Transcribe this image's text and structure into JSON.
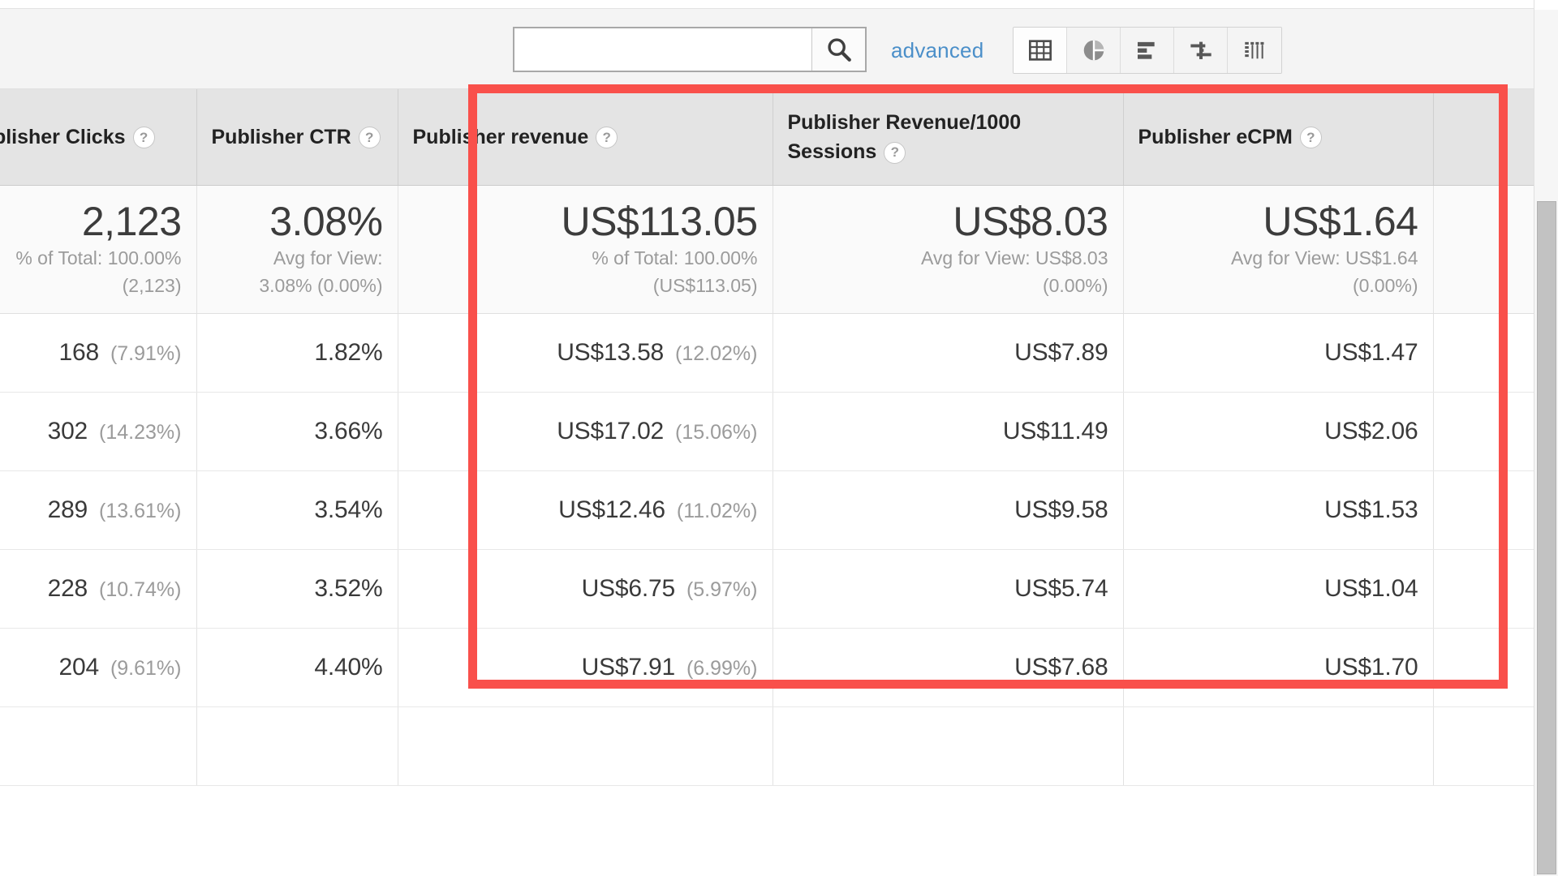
{
  "toolbar": {
    "search_value": "",
    "search_placeholder": "",
    "search_icon": "search-icon",
    "advanced_label": "advanced",
    "view_buttons": [
      {
        "name": "table-view",
        "icon": "table-grid-icon",
        "active": true
      },
      {
        "name": "percentage-view",
        "icon": "pie-chart-icon",
        "active": false
      },
      {
        "name": "performance-view",
        "icon": "horizontal-bar-icon",
        "active": false
      },
      {
        "name": "comparison-view",
        "icon": "pivot-flow-icon",
        "active": false
      },
      {
        "name": "pivot-view",
        "icon": "term-cloud-icon",
        "active": false
      }
    ]
  },
  "annotation": {
    "color": "#f9504b",
    "highlights_columns": [
      "Publisher revenue",
      "Publisher Revenue/1000 Sessions",
      "Publisher eCPM"
    ]
  },
  "table": {
    "columns": [
      {
        "label": "Publisher Clicks",
        "help": "?",
        "truncated_left": true
      },
      {
        "label": "Publisher CTR",
        "help": "?",
        "truncated_left": false
      },
      {
        "label": "Publisher revenue",
        "help": "?",
        "truncated_left": false
      },
      {
        "label": "Publisher Revenue/1000 Sessions",
        "help": "?",
        "truncated_left": false
      },
      {
        "label": "Publisher eCPM",
        "help": "?",
        "truncated_left": false
      }
    ],
    "summary": [
      {
        "main": "2,123",
        "sub1": "% of Total: 100.00%",
        "sub2": "(2,123)"
      },
      {
        "main": "3.08%",
        "sub1": "Avg for View:",
        "sub2": "3.08% (0.00%)"
      },
      {
        "main": "US$113.05",
        "sub1": "% of Total: 100.00%",
        "sub2": "(US$113.05)"
      },
      {
        "main": "US$8.03",
        "sub1": "Avg for View: US$8.03",
        "sub2": "(0.00%)"
      },
      {
        "main": "US$1.64",
        "sub1": "Avg for View: US$1.64",
        "sub2": "(0.00%)"
      }
    ],
    "rows": [
      {
        "clicks": "168",
        "clicks_pct": "(7.91%)",
        "ctr": "1.82%",
        "revenue": "US$13.58",
        "revenue_pct": "(12.02%)",
        "rev_per_1000": "US$7.89",
        "ecpm": "US$1.47"
      },
      {
        "clicks": "302",
        "clicks_pct": "(14.23%)",
        "ctr": "3.66%",
        "revenue": "US$17.02",
        "revenue_pct": "(15.06%)",
        "rev_per_1000": "US$11.49",
        "ecpm": "US$2.06"
      },
      {
        "clicks": "289",
        "clicks_pct": "(13.61%)",
        "ctr": "3.54%",
        "revenue": "US$12.46",
        "revenue_pct": "(11.02%)",
        "rev_per_1000": "US$9.58",
        "ecpm": "US$1.53"
      },
      {
        "clicks": "228",
        "clicks_pct": "(10.74%)",
        "ctr": "3.52%",
        "revenue": "US$6.75",
        "revenue_pct": "(5.97%)",
        "rev_per_1000": "US$5.74",
        "ecpm": "US$1.04"
      },
      {
        "clicks": "204",
        "clicks_pct": "(9.61%)",
        "ctr": "4.40%",
        "revenue": "US$7.91",
        "revenue_pct": "(6.99%)",
        "rev_per_1000": "US$7.68",
        "ecpm": "US$1.70"
      }
    ]
  },
  "scrollbar": {
    "orientation": "vertical",
    "name": "page-scrollbar"
  }
}
